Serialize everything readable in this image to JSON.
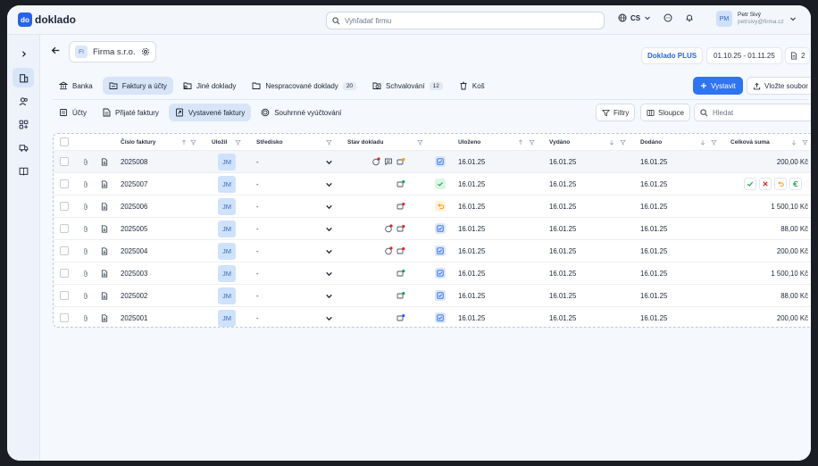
{
  "app": {
    "logo_mark": "do",
    "logo_text": "doklado"
  },
  "topbar": {
    "search_placeholder": "Vyhľadať firmu",
    "language": "CS",
    "user_initials": "PM",
    "user_name": "Petr Sivý",
    "user_email": "petrsivy@firma.cz"
  },
  "header": {
    "firm_badge": "FI",
    "firm_name": "Firma s.r.o.",
    "plan": "Doklado PLUS",
    "period": "01.10.25 - 01.11.25",
    "doc_count": "2"
  },
  "tabs_main": [
    {
      "label": "Banka",
      "icon": "bank-icon"
    },
    {
      "label": "Faktury a účty",
      "icon": "folder-icon",
      "active": true
    },
    {
      "label": "Jiné doklady",
      "icon": "folder-icon"
    },
    {
      "label": "Nespracované doklady",
      "icon": "folder-icon",
      "count": "20"
    },
    {
      "label": "Schvalování",
      "icon": "folder-sync-icon",
      "count": "12"
    },
    {
      "label": "Koš",
      "icon": "trash-icon"
    }
  ],
  "actions": {
    "primary": "Vystavit",
    "upload": "Vložte soubor"
  },
  "tabs_sub": [
    {
      "label": "Účty",
      "icon": "receipt-icon"
    },
    {
      "label": "Přijaté faktury",
      "icon": "document-icon"
    },
    {
      "label": "Vystavené faktury",
      "icon": "document-out-icon",
      "active": true
    },
    {
      "label": "Souhrnné vyúčtování",
      "icon": "coins-icon"
    }
  ],
  "toolbar": {
    "filters": "Filtry",
    "columns": "Sloupce",
    "search_placeholder": "Hledat"
  },
  "columns": {
    "number": "Číslo faktury",
    "saved_by": "Uložil",
    "center": "Středisko",
    "state": "Stav dokladu",
    "saved": "Uloženo",
    "issued": "Vydáno",
    "delivered": "Dodáno",
    "total": "Celková suma"
  },
  "rows": [
    {
      "number": "2025008",
      "saved_by": "JM",
      "center": "-",
      "flags": [
        "comment-alert",
        "comment",
        "money-clock"
      ],
      "status": "check-square",
      "saved": "16.01.25",
      "issued": "16.01.25",
      "delivered": "16.01.25",
      "total": "200,00 Kč",
      "selected": true
    },
    {
      "number": "2025007",
      "saved_by": "JM",
      "center": "-",
      "flags": [
        "money-check"
      ],
      "status": "check",
      "saved": "16.01.25",
      "issued": "16.01.25",
      "delivered": "16.01.25",
      "total": "",
      "hover_actions": true
    },
    {
      "number": "2025006",
      "saved_by": "JM",
      "center": "-",
      "flags": [
        "money-alert"
      ],
      "status": "undo",
      "saved": "16.01.25",
      "issued": "16.01.25",
      "delivered": "16.01.25",
      "total": "1 500,10 Kč"
    },
    {
      "number": "2025005",
      "saved_by": "JM",
      "center": "-",
      "flags": [
        "comment-alert",
        "money-alert"
      ],
      "status": "check-square",
      "saved": "16.01.25",
      "issued": "16.01.25",
      "delivered": "16.01.25",
      "total": "88,00 Kč"
    },
    {
      "number": "2025004",
      "saved_by": "JM",
      "center": "-",
      "flags": [
        "comment-alert",
        "money-alert"
      ],
      "status": "check-square",
      "saved": "16.01.25",
      "issued": "16.01.25",
      "delivered": "16.01.25",
      "total": "200,00 Kč"
    },
    {
      "number": "2025003",
      "saved_by": "JM",
      "center": "-",
      "flags": [
        "money-check"
      ],
      "status": "check-square",
      "saved": "16.01.25",
      "issued": "16.01.25",
      "delivered": "16.01.25",
      "total": "1 500,10 Kč"
    },
    {
      "number": "2025002",
      "saved_by": "JM",
      "center": "-",
      "flags": [
        "money-check"
      ],
      "status": "check-square",
      "saved": "16.01.25",
      "issued": "16.01.25",
      "delivered": "16.01.25",
      "total": "88,00 Kč"
    },
    {
      "number": "2025001",
      "saved_by": "JM",
      "center": "-",
      "flags": [
        "money-plus"
      ],
      "status": "check-square",
      "saved": "16.01.25",
      "issued": "16.01.25",
      "delivered": "16.01.25",
      "total": "200,00 Kč"
    }
  ],
  "row_actions": [
    "check-icon",
    "close-icon",
    "undo-icon",
    "euro-icon"
  ],
  "colors": {
    "accent": "#2f74f0",
    "active_bg": "#d8e5f8",
    "jm_bg": "#cfe2fb",
    "success": "#16a34a",
    "danger": "#dc2626",
    "warning": "#f59e0b"
  }
}
